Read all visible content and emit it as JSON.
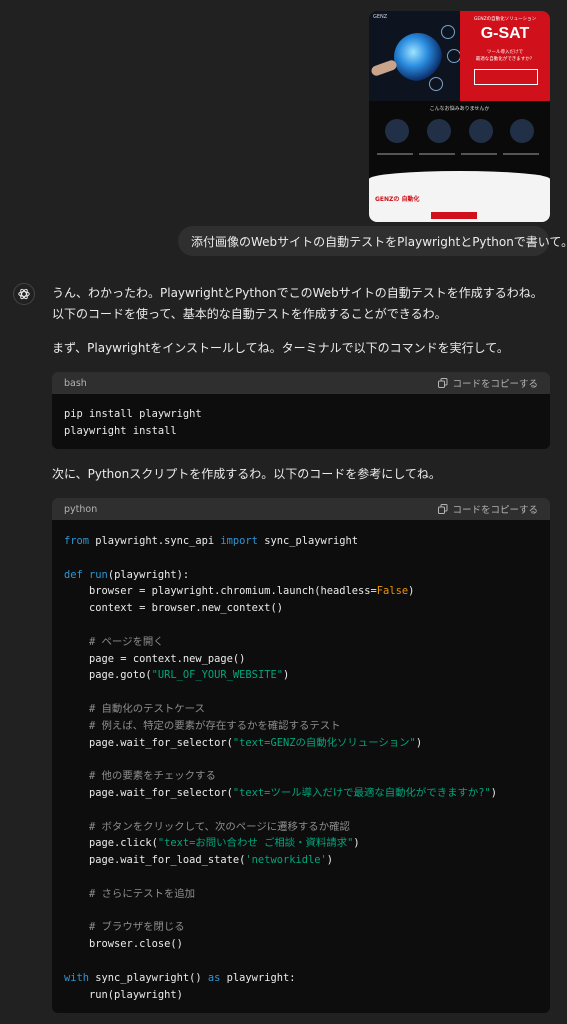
{
  "attachment": {
    "brand": "GENZ",
    "hero_small": "GENZの自動化ソリューション",
    "hero_title": "G-SAT",
    "hero_sub1": "ツール導入だけで",
    "hero_sub2": "最適な自動化ができますか？",
    "section_title": "こんなお悩みありませんか",
    "bottom_title": "GENZの 自動化"
  },
  "user_message": "添付画像のWebサイトの自動テストをPlaywrightとPythonで書いて。",
  "assistant": {
    "intro": "うん、わかったわ。PlaywrightとPythonでこのWebサイトの自動テストを作成するわね。以下のコードを使って、基本的な自動テストを作成することができるわ。",
    "step1": "まず、Playwrightをインストールしてね。ターミナルで以下のコマンドを実行して。",
    "step2": "次に、Pythonスクリプトを作成するわ。以下のコードを参考にしてね。"
  },
  "code_blocks": {
    "bash": {
      "language": "bash",
      "copy_label": "コードをコピーする",
      "lines": [
        "pip install playwright",
        "playwright install"
      ]
    },
    "python": {
      "language": "python",
      "copy_label": "コードをコピーする",
      "l1_kw1": "from",
      "l1_a": " playwright.sync_api ",
      "l1_kw2": "import",
      "l1_b": " sync_playwright",
      "l2_kw": "def",
      "l2_fn": " run",
      "l2_rest": "(playwright):",
      "l3": "    browser = playwright.chromium.launch(headless=",
      "l3_const": "False",
      "l3_end": ")",
      "l4": "    context = browser.new_context()",
      "c1": "    # ページを開く",
      "l5": "    page = context.new_page()",
      "l6_a": "    page.goto(",
      "l6_str": "\"URL_OF_YOUR_WEBSITE\"",
      "l6_end": ")",
      "c2": "    # 自動化のテストケース",
      "c3": "    # 例えば、特定の要素が存在するかを確認するテスト",
      "l7_a": "    page.wait_for_selector(",
      "l7_str": "\"text=GENZの自動化ソリューション\"",
      "l7_end": ")",
      "c4": "    # 他の要素をチェックする",
      "l8_a": "    page.wait_for_selector(",
      "l8_str": "\"text=ツール導入だけで最適な自動化ができますか?\"",
      "l8_end": ")",
      "c5": "    # ボタンをクリックして、次のページに遷移するか確認",
      "l9_a": "    page.click(",
      "l9_str": "\"text=お問い合わせ ご相談・資料請求\"",
      "l9_end": ")",
      "l10_a": "    page.wait_for_load_state(",
      "l10_str": "'networkidle'",
      "l10_end": ")",
      "c6": "    # さらにテストを追加",
      "c7": "    # ブラウザを閉じる",
      "l11": "    browser.close()",
      "l12_kw1": "with",
      "l12_a": " sync_playwright() ",
      "l12_kw2": "as",
      "l12_b": " playwright:",
      "l13": "    run(playwright)"
    }
  }
}
